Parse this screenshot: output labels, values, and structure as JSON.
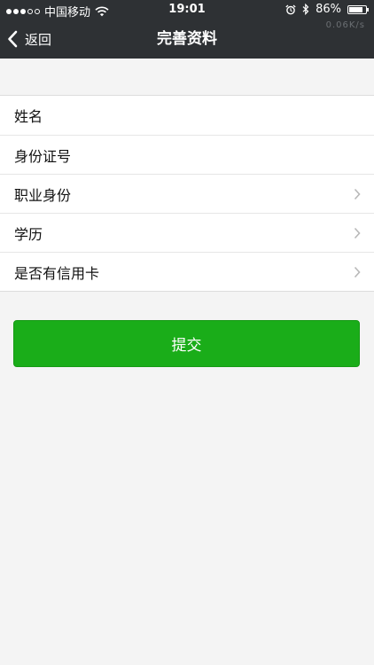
{
  "status_bar": {
    "carrier": "中国移动",
    "time": "19:01",
    "battery": "86%",
    "battery_level": 0.86,
    "net_speed": "0.06K/s"
  },
  "nav": {
    "back_label": "返回",
    "title": "完善资料"
  },
  "form": {
    "rows": [
      {
        "label": "姓名",
        "has_chevron": false
      },
      {
        "label": "身份证号",
        "has_chevron": false
      },
      {
        "label": "职业身份",
        "has_chevron": true
      },
      {
        "label": "学历",
        "has_chevron": true
      },
      {
        "label": "是否有信用卡",
        "has_chevron": true
      }
    ]
  },
  "submit_label": "提交",
  "colors": {
    "header": "#2e3134",
    "primary": "#1aad19",
    "page_bg": "#f4f4f4"
  }
}
